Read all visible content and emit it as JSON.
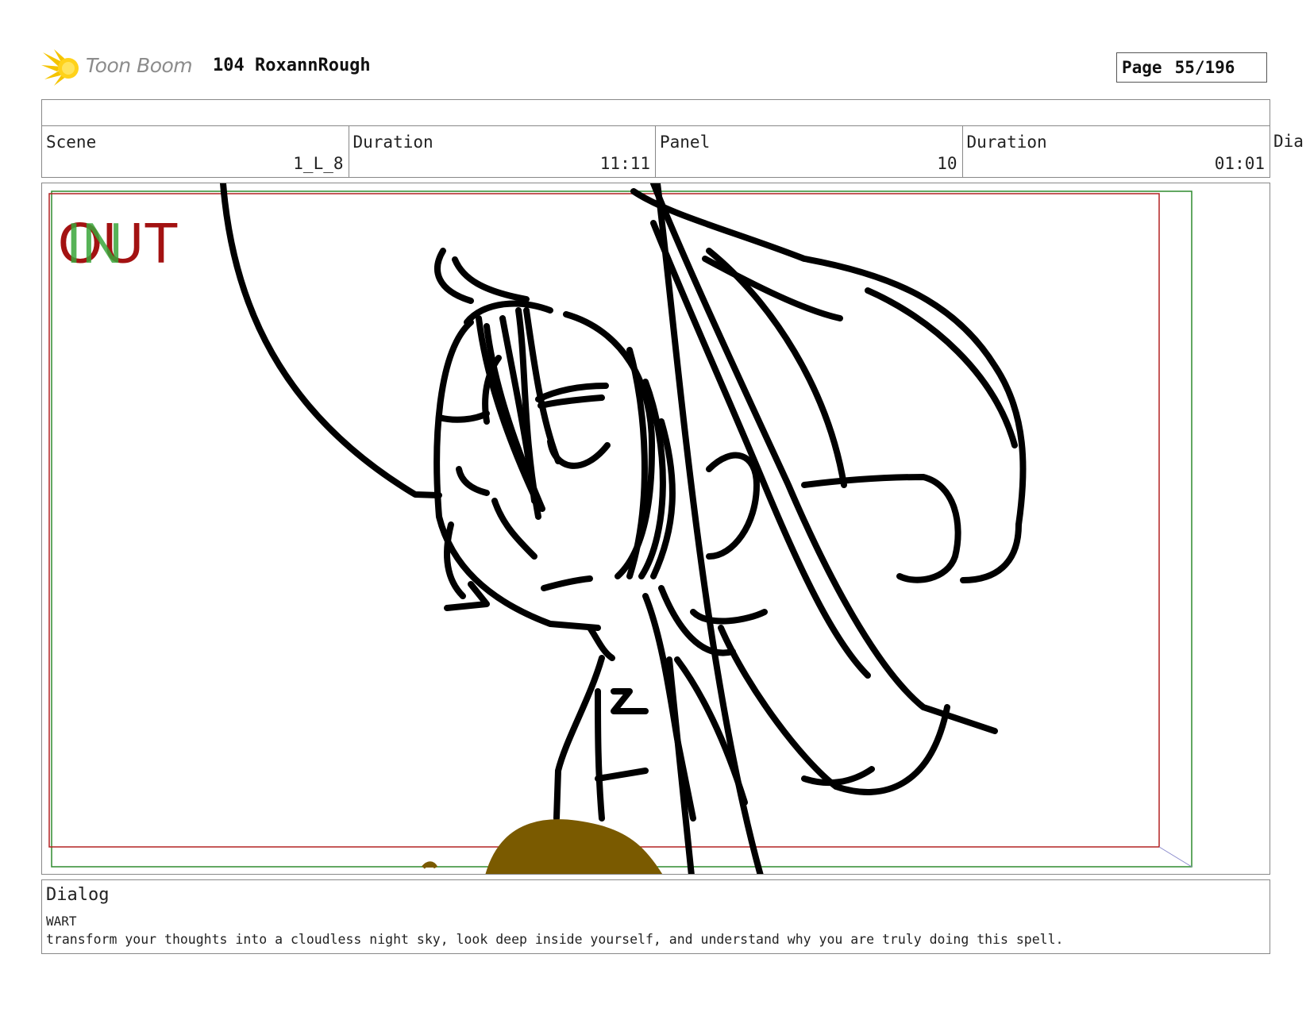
{
  "header": {
    "brand": "Toon Boom",
    "project_title": "104 RoxannRough",
    "page_label": "Page",
    "page_number": "55/196"
  },
  "info": {
    "scene_label": "Scene",
    "scene_value": "1_L_8",
    "duration_label": "Duration",
    "duration_value": "11:11",
    "panel_label": "Panel",
    "panel_value": "10",
    "panel_duration_label": "Duration",
    "panel_duration_value": "01:01",
    "overflow_label": "Dia"
  },
  "panel": {
    "marker_in": "IN",
    "marker_out": "OUT",
    "colors": {
      "in_marker": "#3aa63a",
      "out_marker": "#a31212",
      "red_frame": "#b22222",
      "green_frame": "#2e8b2e",
      "sketch": "#000000",
      "prop": "#7a5a00"
    }
  },
  "dialog": {
    "title": "Dialog",
    "speaker": "WART",
    "line": "transform your thoughts into a cloudless night sky, look deep inside yourself, and understand why you are truly doing this spell."
  }
}
